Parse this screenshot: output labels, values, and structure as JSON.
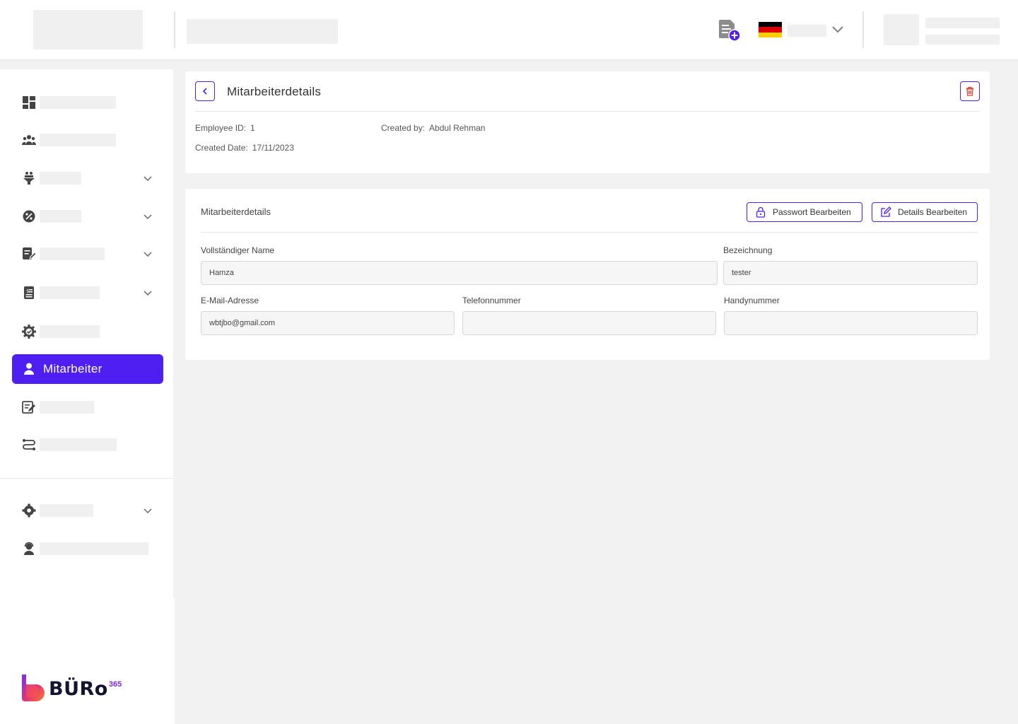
{
  "header": {
    "add_document_icon": "doc-add-icon",
    "language_flag": "germany-flag",
    "flag_colors": [
      "#000000",
      "#dd0000",
      "#ffce00"
    ]
  },
  "sidebar": {
    "active_item": {
      "label": "Mitarbeiter",
      "icon": "user-icon"
    },
    "accent_color": "#4f1ef0",
    "brand": {
      "name": "BÜRo",
      "superscript": "365"
    }
  },
  "detail_card": {
    "title": "Mitarbeiterdetails",
    "employee_id_label": "Employee ID:",
    "employee_id": "1",
    "created_by_label": "Created by:",
    "created_by": "Abdul Rehman",
    "created_date_label": "Created Date:",
    "created_date": "17/11/2023"
  },
  "form_card": {
    "title": "Mitarbeiterdetails",
    "edit_password_label": "Passwort Bearbeiten",
    "edit_details_label": "Details Bearbeiten",
    "fields": {
      "full_name": {
        "label": "Vollständiger Name",
        "value": "Hamza"
      },
      "designation": {
        "label": "Bezeichnung",
        "value": "tester"
      },
      "email": {
        "label": "E-Mail-Adresse",
        "value": "wbtjbo@gmail.com"
      },
      "phone": {
        "label": "Telefonnummer",
        "value": ""
      },
      "mobile": {
        "label": "Handynummer",
        "value": ""
      }
    }
  }
}
